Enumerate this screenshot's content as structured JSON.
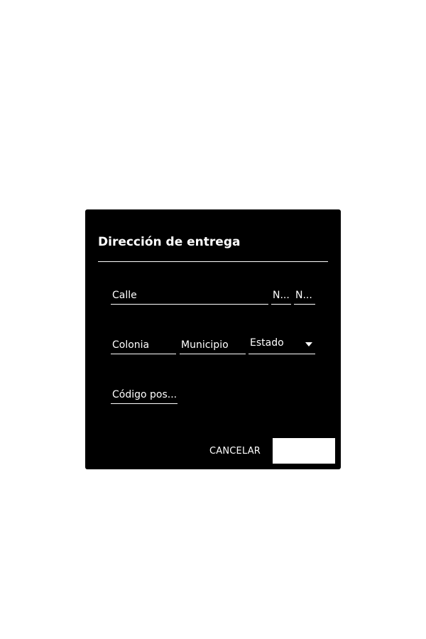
{
  "dialog": {
    "title": "Dirección de entrega",
    "fields": {
      "street": {
        "placeholder": "Calle"
      },
      "number_ext": {
        "placeholder": "N..."
      },
      "number_int": {
        "placeholder": "N..."
      },
      "neighborhood": {
        "placeholder": "Colonia"
      },
      "municipality": {
        "placeholder": "Municipio"
      },
      "state": {
        "value": "Estado"
      },
      "postal_code": {
        "placeholder": "Código pos..."
      }
    },
    "actions": {
      "cancel_label": "CANCELAR"
    }
  },
  "colors": {
    "page_background": "#ffffff",
    "dialog_background": "#000000",
    "text": "#ffffff",
    "save_button_background": "#ffffff"
  }
}
